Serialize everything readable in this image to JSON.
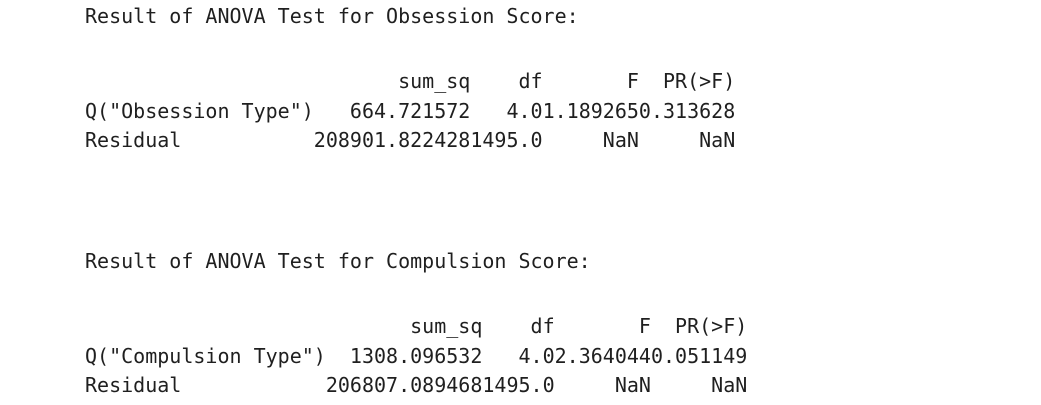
{
  "obsession": {
    "title": "Result of ANOVA Test for Obsession Score:",
    "headers": [
      "",
      "sum_sq",
      "df",
      "F",
      "PR(>F)"
    ],
    "rows": [
      [
        "Q(\"Obsession Type\")",
        "664.721572",
        "4.0",
        "1.189265",
        "0.313628"
      ],
      [
        "Residual",
        "208901.822428",
        "1495.0",
        "NaN",
        "NaN"
      ]
    ]
  },
  "compulsion": {
    "title": "Result of ANOVA Test for Compulsion Score:",
    "headers": [
      "",
      "sum_sq",
      "df",
      "F",
      "PR(>F)"
    ],
    "rows": [
      [
        "Q(\"Compulsion Type\")",
        "1308.096532",
        "4.0",
        "2.364044",
        "0.051149"
      ],
      [
        "Residual",
        "206807.089468",
        "1495.0",
        "NaN",
        "NaN"
      ]
    ]
  }
}
